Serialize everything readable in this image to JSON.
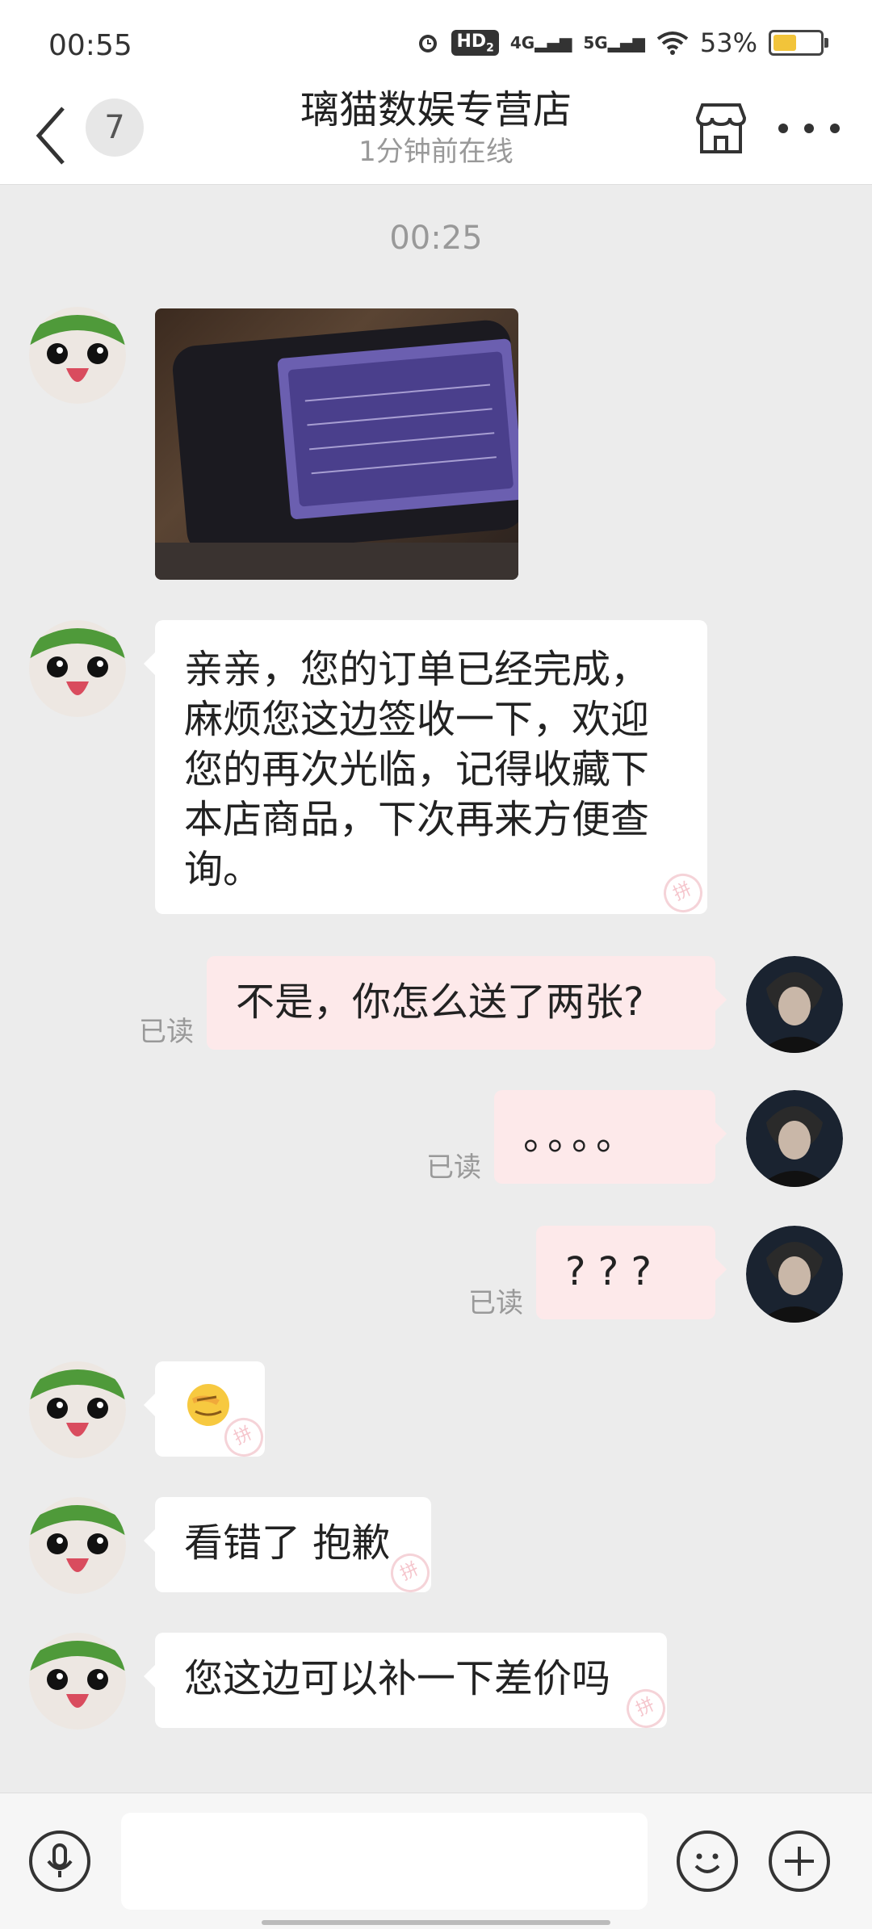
{
  "status_bar": {
    "time": "00:55",
    "hd": "HD",
    "hd_sub": "2",
    "net1": "4G",
    "net2": "5G",
    "battery": "53%"
  },
  "header": {
    "unread_count": "7",
    "title": "璃猫数娱专营店",
    "subtitle": "1分钟前在线"
  },
  "chat": {
    "timestamp": "00:25",
    "messages": [
      {
        "side": "left",
        "type": "image"
      },
      {
        "side": "left",
        "type": "text",
        "lines": [
          "亲亲，您的订单已经完成，",
          "麻烦您这边签收一下，欢迎",
          "您的再次光临，记得收藏下",
          "本店商品，下次再来方便查",
          "询。"
        ]
      },
      {
        "side": "right",
        "type": "text",
        "text": "不是，你怎么送了两张?",
        "read": "已读"
      },
      {
        "side": "right",
        "type": "text",
        "text": "。。。。",
        "read": "已读"
      },
      {
        "side": "right",
        "type": "text",
        "text": "? ? ?",
        "read": "已读"
      },
      {
        "side": "left",
        "type": "emoji",
        "text": "🤦"
      },
      {
        "side": "left",
        "type": "text",
        "text": "看错了 抱歉"
      },
      {
        "side": "left",
        "type": "text",
        "text": "您这边可以补一下差价吗"
      }
    ]
  },
  "watermark_char": "拼",
  "colors": {
    "background": "#ececec",
    "bubble_left": "#ffffff",
    "bubble_right": "#fde9ea",
    "muted_text": "#999999"
  }
}
